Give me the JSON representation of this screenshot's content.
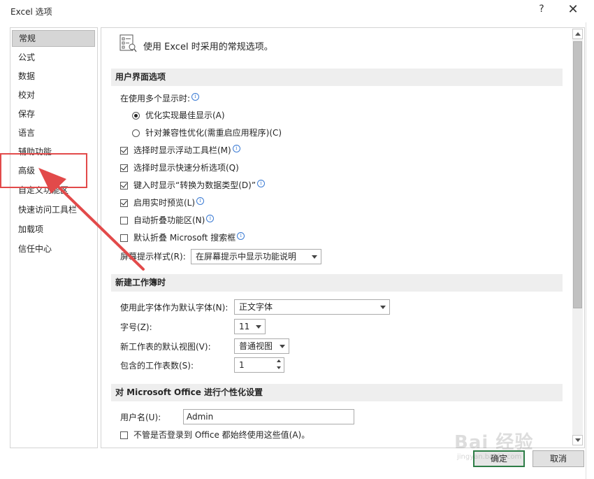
{
  "window": {
    "title": "Excel 选项",
    "help_label": "?",
    "close_label": "✕"
  },
  "nav": {
    "items": [
      {
        "label": "常规",
        "selected": true
      },
      {
        "label": "公式"
      },
      {
        "label": "数据"
      },
      {
        "label": "校对"
      },
      {
        "label": "保存"
      },
      {
        "label": "语言"
      },
      {
        "label": "辅助功能"
      },
      {
        "label": "高级"
      },
      {
        "label": "自定义功能区"
      },
      {
        "label": "快速访问工具栏"
      },
      {
        "label": "加载项"
      },
      {
        "label": "信任中心"
      }
    ]
  },
  "content": {
    "header_text": "使用 Excel 时采用的常规选项。",
    "section_ui": {
      "title": "用户界面选项",
      "multi_display_label": "在使用多个显示时:",
      "radio_optimize": "优化实现最佳显示(A)",
      "radio_compat": "针对兼容性优化(需重启应用程序)(C)",
      "cb_minitoolbar": "选择时显示浮动工具栏(M)",
      "cb_quickanalysis": "选择时显示快速分析选项(Q)",
      "cb_convert": "键入时显示“转换为数据类型(D)”",
      "cb_livepreview": "启用实时预览(L)",
      "cb_collapse": "自动折叠功能区(N)",
      "cb_search": "默认折叠 Microsoft 搜索框",
      "screentip_label": "屏幕提示样式(R):",
      "screentip_value": "在屏幕提示中显示功能说明"
    },
    "section_workbook": {
      "title": "新建工作簿时",
      "font_label": "使用此字体作为默认字体(N):",
      "font_value": "正文字体",
      "size_label": "字号(Z):",
      "size_value": "11",
      "view_label": "新工作表的默认视图(V):",
      "view_value": "普通视图",
      "sheets_label": "包含的工作表数(S):",
      "sheets_value": "1"
    },
    "section_personal": {
      "title": "对 Microsoft Office 进行个性化设置",
      "username_label": "用户名(U):",
      "username_value": "Admin",
      "cb_always": "不管是否登录到 Office 都始终使用这些值(A)。"
    }
  },
  "buttons": {
    "ok": "确定",
    "cancel": "取消"
  },
  "watermark": {
    "text": "Bai 经验",
    "sub": "jingyan.baidu.com"
  },
  "colors": {
    "annotation": "#e24a4a",
    "primary_border": "#2d7d46",
    "section_bg": "#eeeeee",
    "selected_nav_bg": "#d6d6d6"
  }
}
